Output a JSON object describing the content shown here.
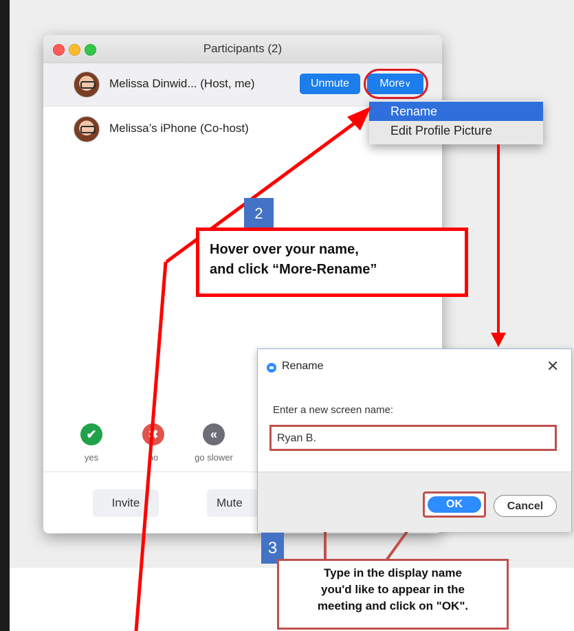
{
  "participants_window": {
    "title": "Participants (2)",
    "participants": [
      {
        "name": "Melissa Dinwid...  (Host, me)",
        "buttons": {
          "unmute": "Unmute",
          "more": "More"
        }
      },
      {
        "name": "Melissa’s iPhone (Co-host)"
      }
    ],
    "more_chevron": "∨",
    "feedback": [
      {
        "label": "yes",
        "icon": "check-icon",
        "symbol": "✔",
        "color": "#1fa24a"
      },
      {
        "label": "no",
        "icon": "x-icon",
        "symbol": "✖",
        "color": "#e0534b"
      },
      {
        "label": "go slower",
        "icon": "rewind-icon",
        "symbol": "«",
        "color": "#6d6d78"
      }
    ],
    "bottom_buttons": {
      "invite": "Invite",
      "mute": "Mute"
    }
  },
  "more_menu": {
    "items": [
      "Rename",
      "Edit Profile Picture"
    ],
    "selected": "Rename"
  },
  "rename_dialog": {
    "title": "Rename",
    "close_symbol": "✕",
    "prompt": "Enter a new screen name:",
    "input_value": "Ryan B.",
    "ok_label": "OK",
    "cancel_label": "Cancel"
  },
  "annotations": {
    "step2_number": "2",
    "step2_lines": [
      "Hover over your name,",
      "and click “More-Rename”"
    ],
    "step3_number": "3",
    "step3_lines": [
      "Type in the display name",
      "you'd like to appear in the",
      "meeting and click on \"OK\"."
    ]
  },
  "colors": {
    "accent_blue": "#1c7ded",
    "annotation_red": "#ff0000",
    "callout_red": "#c0504d",
    "step_badge_blue": "#4472c4"
  }
}
